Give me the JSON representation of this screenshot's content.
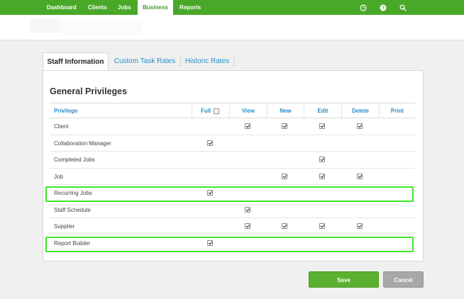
{
  "nav": {
    "items": [
      {
        "label": "Dashboard"
      },
      {
        "label": "Clients"
      },
      {
        "label": "Jobs"
      },
      {
        "label": "Business",
        "active": true
      },
      {
        "label": "Reports"
      }
    ],
    "icons": [
      "clock-icon",
      "help-icon",
      "search-icon"
    ]
  },
  "tabs": [
    {
      "label": "Staff Information",
      "active": true
    },
    {
      "label": "Custom Task Rates"
    },
    {
      "label": "Historic Rates"
    }
  ],
  "section": {
    "title": "General Privileges"
  },
  "table": {
    "headers": [
      "Privilege",
      "Full",
      "View",
      "New",
      "Edit",
      "Delete",
      "Print"
    ],
    "rows": [
      {
        "label": "Client",
        "full": false,
        "view": true,
        "new": true,
        "edit": true,
        "delete": true,
        "print": false
      },
      {
        "label": "Collaboration Manager",
        "full": true,
        "view": false,
        "new": false,
        "edit": false,
        "delete": false,
        "print": false
      },
      {
        "label": "Completed Jobs",
        "full": false,
        "view": false,
        "new": false,
        "edit": true,
        "delete": false,
        "print": false
      },
      {
        "label": "Job",
        "full": false,
        "view": false,
        "new": true,
        "edit": true,
        "delete": true,
        "print": false
      },
      {
        "label": "Recurring Jobs",
        "full": true,
        "view": false,
        "new": false,
        "edit": false,
        "delete": false,
        "print": false,
        "highlighted": true
      },
      {
        "label": "Staff Schedule",
        "full": false,
        "view": true,
        "new": false,
        "edit": false,
        "delete": false,
        "print": false
      },
      {
        "label": "Supplier",
        "full": false,
        "view": true,
        "new": true,
        "edit": true,
        "delete": true,
        "print": false
      },
      {
        "label": "Report Builder",
        "full": true,
        "view": false,
        "new": false,
        "edit": false,
        "delete": false,
        "print": false,
        "highlighted": true
      }
    ]
  },
  "buttons": {
    "save": "Save",
    "cancel": "Cancel"
  },
  "colors": {
    "brand": "#4aa829",
    "link": "#2a8dc6",
    "highlight": "#3ee629",
    "save": "#5bb12f",
    "cancel": "#a8a8a8"
  }
}
